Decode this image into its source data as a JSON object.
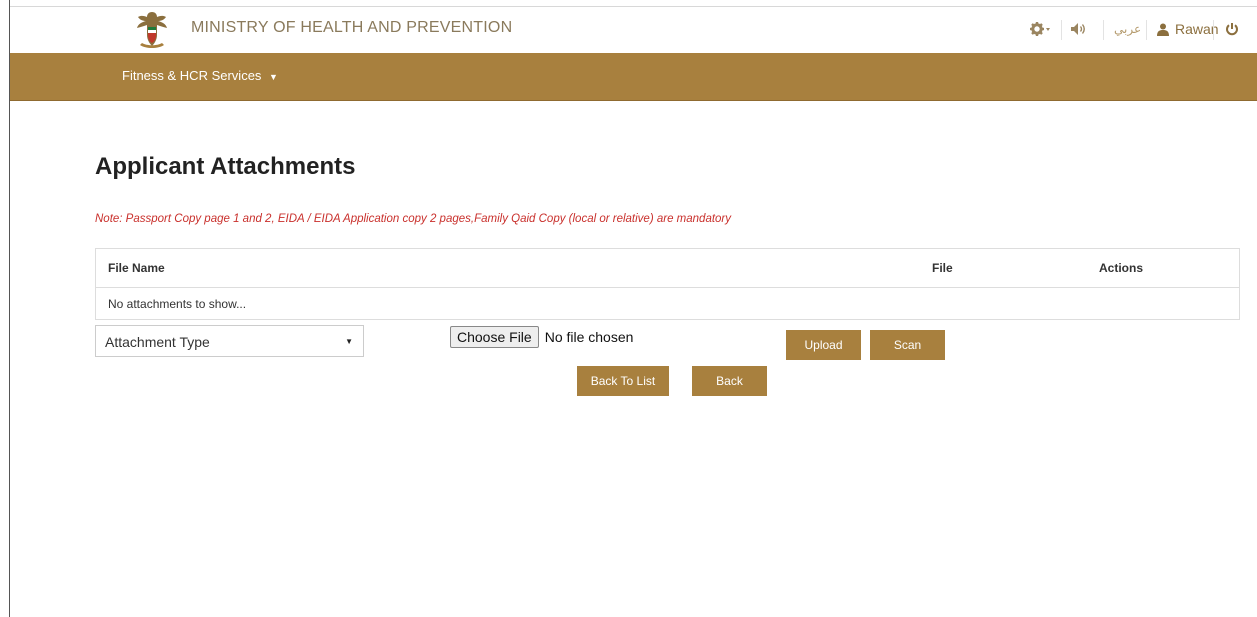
{
  "header": {
    "ministry_name": "MINISTRY OF HEALTH AND PREVENTION",
    "language_label": "عربي",
    "user_name": "Rawan",
    "icons": [
      "eagle-emblem-icon",
      "gear-icon",
      "speaker-icon",
      "user-icon",
      "power-icon"
    ]
  },
  "nav": {
    "menu_label": "Fitness & HCR Services"
  },
  "page": {
    "title": "Applicant Attachments",
    "note": "Note: Passport Copy page 1 and 2, EIDA / EIDA Application copy 2 pages,Family Qaid Copy (local or relative) are mandatory"
  },
  "table": {
    "headers": {
      "file_name": "File Name",
      "file": "File",
      "actions": "Actions"
    },
    "empty_message": "No attachments to show..."
  },
  "form": {
    "attachment_type": "Attachment Type",
    "choose_file_label": "Choose File",
    "file_status": "No file chosen",
    "upload_label": "Upload",
    "scan_label": "Scan",
    "back_to_list_label": "Back To List",
    "back_label": "Back"
  },
  "colors": {
    "brand_gold": "#a8803e",
    "note_red": "#c9302c",
    "ministry_text": "#8a7a5c"
  }
}
